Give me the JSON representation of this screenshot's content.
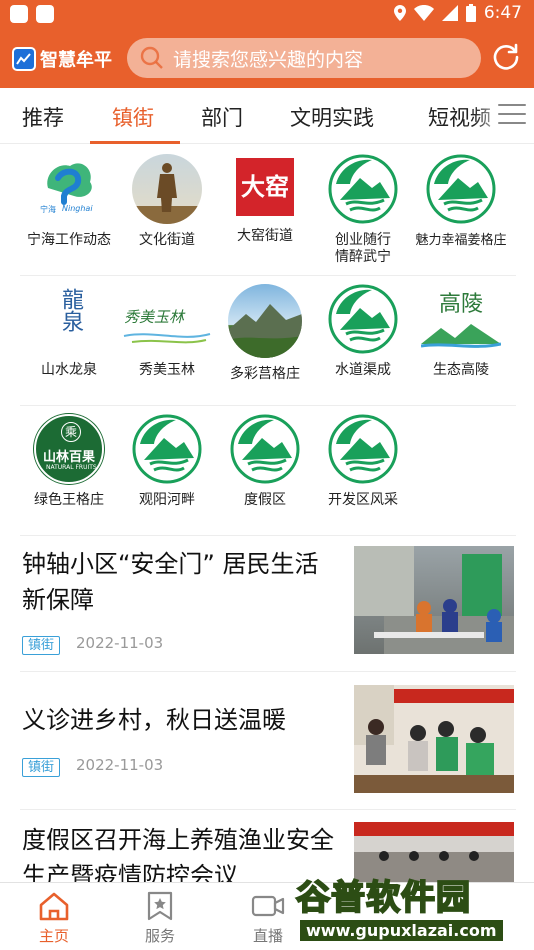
{
  "status_bar": {
    "time": "6:47"
  },
  "app_bar": {
    "logo_text": "智慧牟平",
    "search_placeholder": "请搜索您感兴趣的内容"
  },
  "tabs": [
    {
      "label": "推荐",
      "active": false
    },
    {
      "label": "镇街",
      "active": true
    },
    {
      "label": "部门",
      "active": false
    },
    {
      "label": "文明实践",
      "active": false
    },
    {
      "label": "短视频",
      "active": false
    }
  ],
  "channels": [
    {
      "label": "宁海工作动态",
      "icon": "ninghai-logo"
    },
    {
      "label": "文化街道",
      "icon": "statue-photo"
    },
    {
      "label": "大窑街道",
      "icon": "dayao-logo"
    },
    {
      "label": "创业随行\n情醉武宁",
      "icon": "green-mountain-logo"
    },
    {
      "label": "魅力幸福姜格庄",
      "icon": "green-mountain-logo"
    },
    {
      "label": "山水龙泉",
      "icon": "longquan-calligraphy"
    },
    {
      "label": "秀美玉林",
      "icon": "yulin-calligraphy"
    },
    {
      "label": "多彩莒格庄",
      "icon": "mountain-photo"
    },
    {
      "label": "水道渠成",
      "icon": "green-mountain-logo"
    },
    {
      "label": "生态高陵",
      "icon": "gaoling-logo"
    },
    {
      "label": "绿色王格庄",
      "icon": "shanlinbaiguo-logo"
    },
    {
      "label": "观阳河畔",
      "icon": "green-mountain-logo"
    },
    {
      "label": "度假区",
      "icon": "green-mountain-logo"
    },
    {
      "label": "开发区风采",
      "icon": "green-mountain-logo"
    }
  ],
  "channel_logo_text": {
    "ninghai_cn": "宁海",
    "ninghai_en": "Ninghai",
    "dayao": "大窑",
    "longquan": "龍泉",
    "yulin": "秀美玉林",
    "gaoling": "高陵",
    "shanlin_top": "乘",
    "shanlin_main": "山林百果",
    "shanlin_en": "NATURAL FRUITS"
  },
  "news": [
    {
      "title": "钟轴小区“安全门” 居民生活新保障",
      "tag": "镇街",
      "date": "2022-11-03"
    },
    {
      "title": "义诊进乡村，秋日送温暖",
      "tag": "镇街",
      "date": "2022-11-03"
    },
    {
      "title": "度假区召开海上养殖渔业安全生产暨疫情防控会议",
      "tag": "",
      "date": ""
    }
  ],
  "bottom_nav": [
    {
      "label": "主页",
      "icon": "home-icon",
      "active": true
    },
    {
      "label": "服务",
      "icon": "bookmark-star-icon",
      "active": false
    },
    {
      "label": "直播",
      "icon": "video-icon",
      "active": false
    }
  ],
  "watermark": {
    "title": "谷普软件园",
    "url": "www.gupuxlazai.com"
  },
  "colors": {
    "brand": "#e8602c",
    "tag": "#3aa0d8",
    "logo_green": "#19a05a"
  }
}
